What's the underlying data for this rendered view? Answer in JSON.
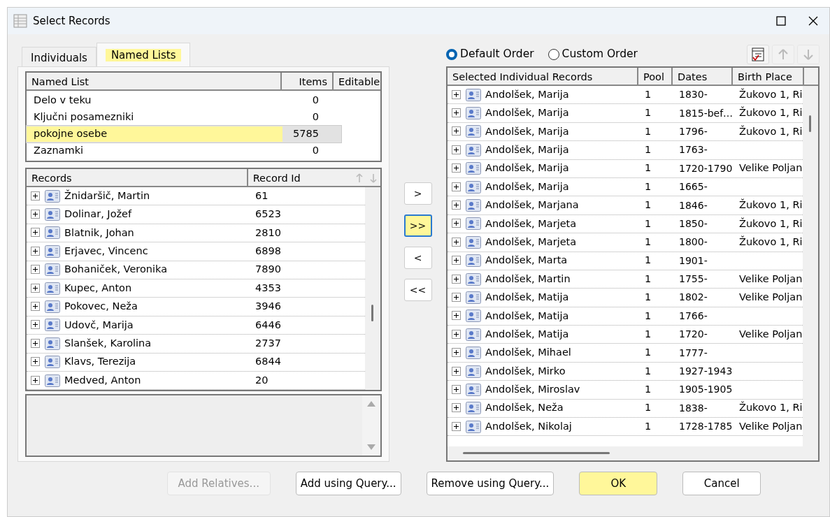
{
  "window": {
    "title": "Select Records"
  },
  "tabs": [
    {
      "label": "Individuals",
      "selected": false,
      "highlighted": false
    },
    {
      "label": "Named Lists",
      "selected": true,
      "highlighted": true
    }
  ],
  "named_lists": {
    "columns": [
      "Named List",
      "Items",
      "Editable"
    ],
    "rows": [
      {
        "name": "Delo v teku",
        "items": "0",
        "selected": false,
        "highlighted": false
      },
      {
        "name": "Ključni posamezniki",
        "items": "0",
        "selected": false,
        "highlighted": false
      },
      {
        "name": "pokojne osebe",
        "items": "5785",
        "selected": true,
        "highlighted": true
      },
      {
        "name": "Zaznamki",
        "items": "0",
        "selected": false,
        "highlighted": false
      }
    ]
  },
  "records": {
    "columns": [
      "Records",
      "Record Id"
    ],
    "rows": [
      {
        "name": "Žnidaršič, Martin",
        "id": "61"
      },
      {
        "name": "Dolinar, Jožef",
        "id": "6523"
      },
      {
        "name": "Blatnik, Johan",
        "id": "2810"
      },
      {
        "name": "Erjavec, Vincenc",
        "id": "6898"
      },
      {
        "name": "Bohaniček, Veronika",
        "id": "7890"
      },
      {
        "name": "Kupec, Anton",
        "id": "4353"
      },
      {
        "name": "Pokovec, Neža",
        "id": "3946"
      },
      {
        "name": "Udovč, Marija",
        "id": "6446"
      },
      {
        "name": "Slanšek, Karolina",
        "id": "2737"
      },
      {
        "name": "Klavs, Terezija",
        "id": "6844"
      },
      {
        "name": "Medved, Anton",
        "id": "20"
      }
    ]
  },
  "transfer_buttons": [
    {
      "label": ">",
      "highlighted": false
    },
    {
      "label": ">>",
      "highlighted": true
    },
    {
      "label": "<",
      "highlighted": false
    },
    {
      "label": "<<",
      "highlighted": false
    }
  ],
  "order": [
    {
      "label": "Default Order",
      "selected": true
    },
    {
      "label": "Custom Order",
      "selected": false
    }
  ],
  "selected_records": {
    "columns": [
      "Selected Individual Records",
      "Pool",
      "Dates",
      "Birth Place"
    ],
    "rows": [
      {
        "name": "Andolšek, Marija",
        "pool": "1",
        "dates": "1830-",
        "place": "Žukovo 1, Ri"
      },
      {
        "name": "Andolšek, Marija",
        "pool": "1",
        "dates": "1815-bef…",
        "place": "Žukovo 1, Ri"
      },
      {
        "name": "Andolšek, Marija",
        "pool": "1",
        "dates": "1796-",
        "place": "Žukovo 1, Ri"
      },
      {
        "name": "Andolšek, Marija",
        "pool": "1",
        "dates": "1763-"
      },
      {
        "name": "Andolšek, Marija",
        "pool": "1",
        "dates": "1720-1790",
        "place": "Velike Poljan"
      },
      {
        "name": "Andolšek, Marija",
        "pool": "1",
        "dates": "1665-"
      },
      {
        "name": "Andolšek, Marjana",
        "pool": "1",
        "dates": "1846-",
        "place": "Žukovo 1, Ri"
      },
      {
        "name": "Andolšek, Marjeta",
        "pool": "1",
        "dates": "1850-",
        "place": "Žukovo 1, Ri"
      },
      {
        "name": "Andolšek, Marjeta",
        "pool": "1",
        "dates": "1800-",
        "place": "Žukovo 1, Ri"
      },
      {
        "name": "Andolšek, Marta",
        "pool": "1",
        "dates": "1901-"
      },
      {
        "name": "Andolšek, Martin",
        "pool": "1",
        "dates": "1755-",
        "place": "Velike Poljan"
      },
      {
        "name": "Andolšek, Matija",
        "pool": "1",
        "dates": "1802-",
        "place": "Velike Poljan"
      },
      {
        "name": "Andolšek, Matija",
        "pool": "1",
        "dates": "1766-"
      },
      {
        "name": "Andolšek, Matija",
        "pool": "1",
        "dates": "1720-",
        "place": "Velike Poljan"
      },
      {
        "name": "Andolšek, Mihael",
        "pool": "1",
        "dates": "1777-"
      },
      {
        "name": "Andolšek, Mirko",
        "pool": "1",
        "dates": "1927-1943"
      },
      {
        "name": "Andolšek, Miroslav",
        "pool": "1",
        "dates": "1905-1905"
      },
      {
        "name": "Andolšek, Neža",
        "pool": "1",
        "dates": "1838-",
        "place": "Žukovo 1, Ri"
      },
      {
        "name": "Andolšek, Nikolaj",
        "pool": "1",
        "dates": "1728-1785",
        "place": "Velike Poljan"
      }
    ]
  },
  "footer_buttons": [
    {
      "label": "Add Relatives...",
      "disabled": true,
      "highlighted": false
    },
    {
      "label": "Add using Query...",
      "disabled": false,
      "highlighted": false
    },
    {
      "label": "Remove using Query...",
      "disabled": false,
      "highlighted": false
    },
    {
      "label": "OK",
      "disabled": false,
      "highlighted": true
    },
    {
      "label": "Cancel",
      "disabled": false,
      "highlighted": false
    }
  ]
}
